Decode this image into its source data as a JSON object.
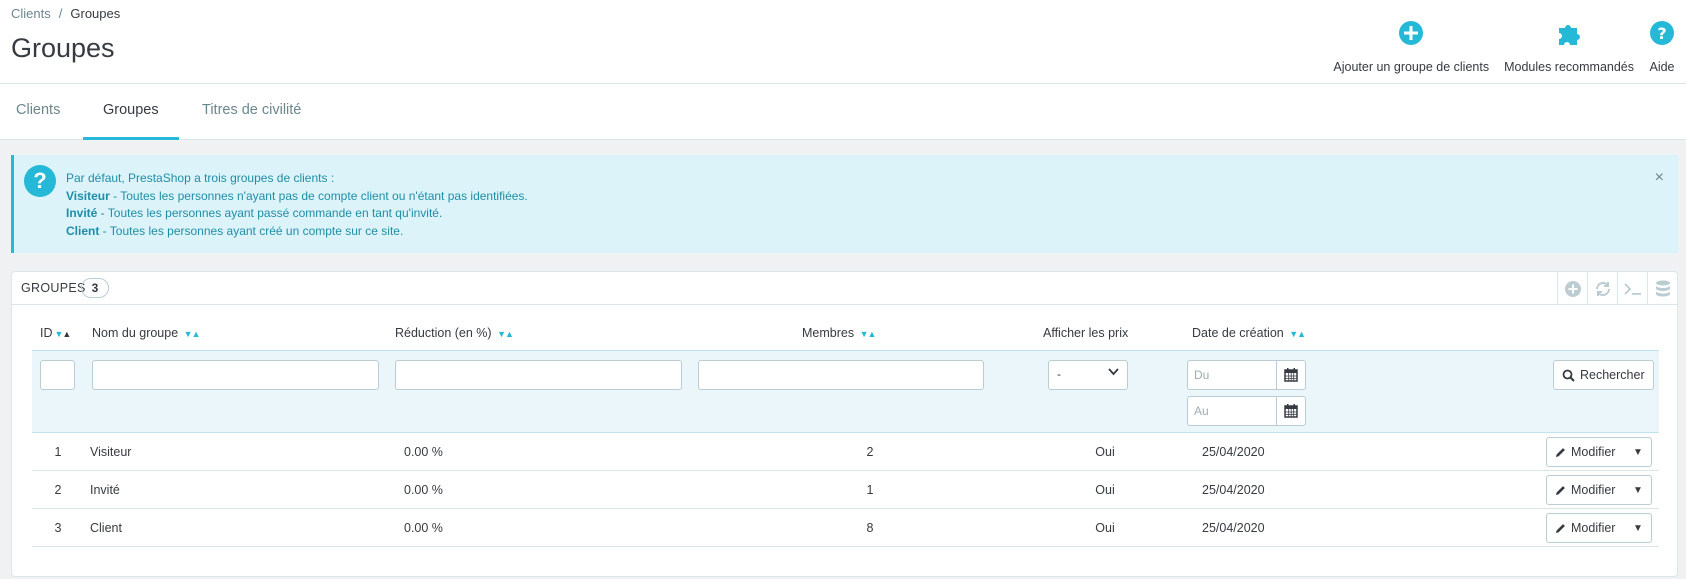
{
  "breadcrumb": {
    "parent": "Clients",
    "separator": "/",
    "current": "Groupes"
  },
  "page_title": "Groupes",
  "toolbar": {
    "add_group": "Ajouter un groupe de clients",
    "recommended_modules": "Modules recommandés",
    "help": "Aide"
  },
  "tabs": [
    {
      "label": "Clients"
    },
    {
      "label": "Groupes",
      "active": true
    },
    {
      "label": "Titres de civilité"
    }
  ],
  "alert": {
    "intro": "Par défaut, PrestaShop a trois groupes de clients :",
    "lines": [
      {
        "title": "Visiteur",
        "desc": " - Toutes les personnes n'ayant pas de compte client ou n'étant pas identifiées."
      },
      {
        "title": "Invité",
        "desc": " - Toutes les personnes ayant passé commande en tant qu'invité."
      },
      {
        "title": "Client",
        "desc": " - Toutes les personnes ayant créé un compte sur ce site."
      }
    ]
  },
  "panel": {
    "title": "GROUPES",
    "count": "3"
  },
  "table": {
    "headers": {
      "id": "ID",
      "name": "Nom du groupe",
      "reduction": "Réduction (en %)",
      "members": "Membres",
      "show_prices": "Afficher les prix",
      "created": "Date de création"
    },
    "filters": {
      "show_prices_selected": "-",
      "date_from_placeholder": "Du",
      "date_to_placeholder": "Au",
      "search_label": "Rechercher"
    },
    "rows": [
      {
        "id": "1",
        "name": "Visiteur",
        "reduction": "0.00 %",
        "members": "2",
        "show_prices": "Oui",
        "created": "25/04/2020"
      },
      {
        "id": "2",
        "name": "Invité",
        "reduction": "0.00 %",
        "members": "1",
        "show_prices": "Oui",
        "created": "25/04/2020"
      },
      {
        "id": "3",
        "name": "Client",
        "reduction": "0.00 %",
        "members": "8",
        "show_prices": "Oui",
        "created": "25/04/2020"
      }
    ],
    "edit_label": "Modifier"
  },
  "colors": {
    "accent": "#25b9d7",
    "text": "#363a41",
    "alert_bg": "#dcf4f9"
  }
}
